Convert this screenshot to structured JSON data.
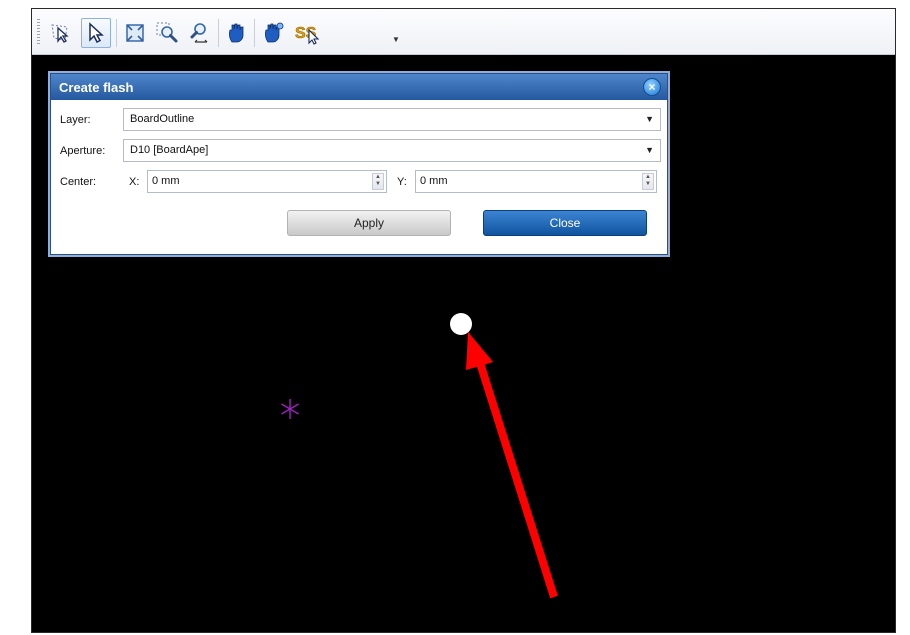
{
  "toolbar": {
    "buttons": [
      {
        "name": "lasso-select-icon"
      },
      {
        "name": "pointer-select-icon",
        "active": true
      },
      {
        "name": "zoom-extents-icon"
      },
      {
        "name": "zoom-window-icon"
      },
      {
        "name": "zoom-pan-icon"
      },
      {
        "name": "pan-hand-icon"
      },
      {
        "name": "pan-hand-alt-icon"
      },
      {
        "name": "snap-select-icon"
      }
    ]
  },
  "dialog": {
    "title": "Create flash",
    "close_glyph": "×",
    "layer": {
      "label": "Layer:",
      "value": "BoardOutline"
    },
    "aperture": {
      "label": "Aperture:",
      "value": "D10 [BoardApe]"
    },
    "center": {
      "label": "Center:",
      "x": {
        "label": "X:",
        "value": "0 mm"
      },
      "y": {
        "label": "Y:",
        "value": "0 mm"
      }
    },
    "apply_label": "Apply",
    "close_label": "Close"
  },
  "canvas": {
    "background": "#000000",
    "flash_color": "#ffffff",
    "origin_color": "#a020c0",
    "annotation_color": "#ff0000"
  }
}
